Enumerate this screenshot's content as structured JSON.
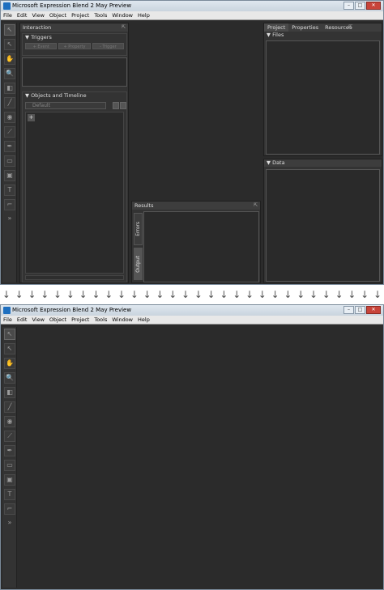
{
  "window_title": "Microsoft Expression Blend 2 May Preview",
  "window_controls": [
    "–",
    "□",
    "✕"
  ],
  "menu": [
    "File",
    "Edit",
    "View",
    "Object",
    "Project",
    "Tools",
    "Window",
    "Help"
  ],
  "tools": [
    "selection-tool-icon",
    "direct-selection-tool-icon",
    "pan-tool-icon",
    "zoom-tool-icon",
    "camera-orbit-tool-icon",
    "eyedropper-tool-icon",
    "paint-bucket-tool-icon",
    "brush-transform-tool-icon",
    "pen-tool-icon",
    "rectangle-tool-icon",
    "layout-panel-tool-icon",
    "text-tool-icon",
    "control-tool-icon",
    "asset-library-icon"
  ],
  "tool_glyphs": [
    "↖",
    "↖",
    "✋",
    "🔍",
    "◧",
    "╱",
    "◉",
    "⟋",
    "✒",
    "▭",
    "▣",
    "T",
    "⌐",
    "»"
  ],
  "interaction": {
    "title": "Interaction",
    "triggers_label": "▼ Triggers",
    "trigger_buttons": [
      "+ Event",
      "+ Property",
      "- Trigger"
    ],
    "objects_label": "▼ Objects and Timeline",
    "timeline_default": "Default",
    "add_button": "+"
  },
  "results": {
    "title": "Results",
    "tabs": [
      "Errors",
      "Output"
    ]
  },
  "right_panel": {
    "tabs": [
      "Project",
      "Properties",
      "Resources"
    ],
    "files_label": "▼ Files",
    "data_label": "▼ Data"
  },
  "arrow_glyph": "↓",
  "arrow_count": 30
}
